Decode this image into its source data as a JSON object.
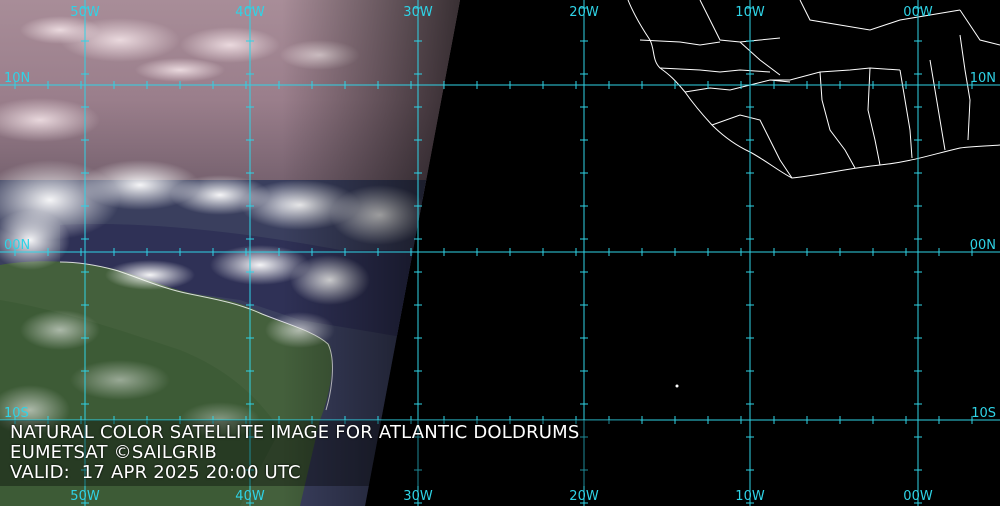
{
  "map": {
    "lon_labels": [
      "50W",
      "40W",
      "30W",
      "20W",
      "10W",
      "00W"
    ],
    "lat_labels_left": [
      "10N",
      "00N",
      "10S"
    ],
    "lat_labels_right": [
      "10N",
      "00N",
      "10S"
    ],
    "grid_color": "#2fd3e6",
    "coast_color": "#ffffff"
  },
  "caption": {
    "line1": "NATURAL COLOR SATELLITE IMAGE FOR ATLANTIC DOLDRUMS",
    "line2": "EUMETSAT ©SAILGRIB",
    "line3": "VALID:  17 APR 2025 20:00 UTC"
  }
}
